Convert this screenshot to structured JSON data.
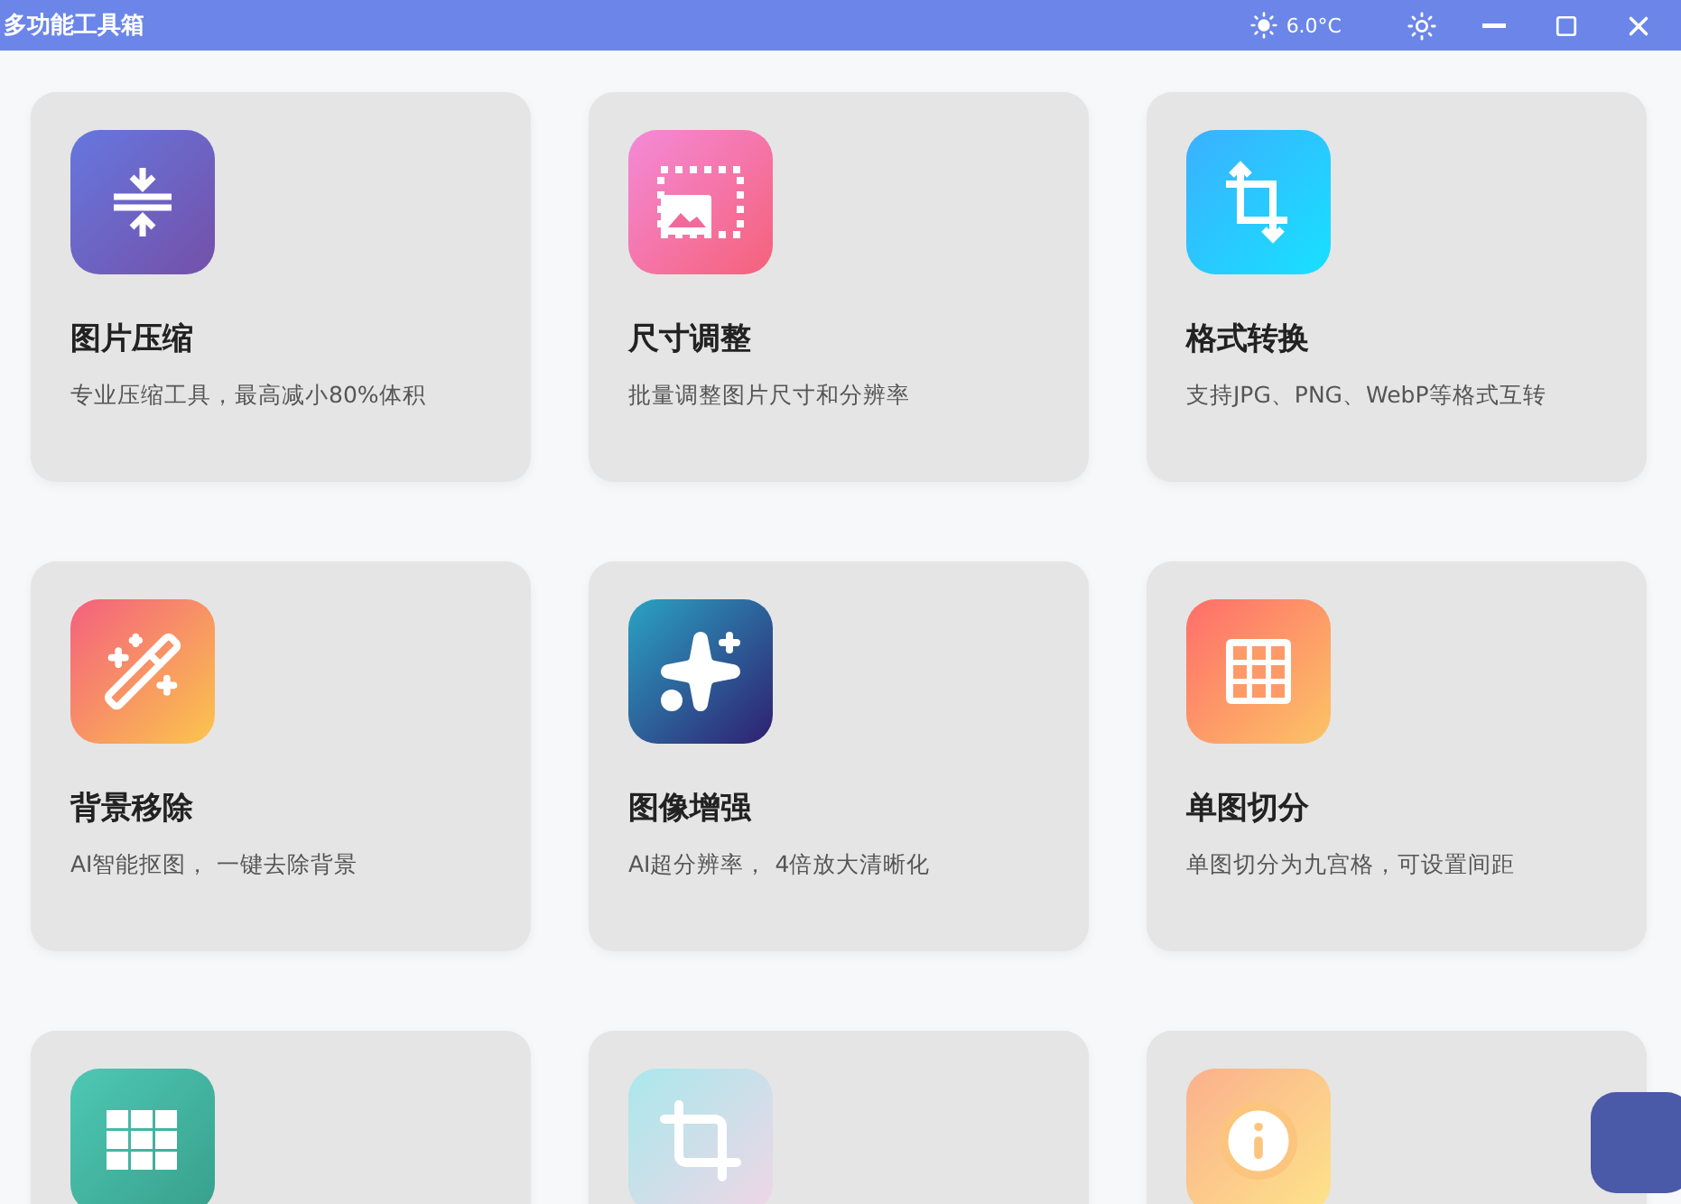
{
  "window": {
    "title": "多功能工具箱",
    "temperature": "6.0°C"
  },
  "tools": [
    {
      "kind": "compress",
      "title": "图片压缩",
      "description": "专业压缩工具，最高减小80%体积"
    },
    {
      "kind": "resize",
      "title": "尺寸调整",
      "description": "批量调整图片尺寸和分辨率"
    },
    {
      "kind": "convert",
      "title": "格式转换",
      "description": "支持JPG、PNG、WebP等格式互转"
    },
    {
      "kind": "wand",
      "title": "背景移除",
      "description": "AI智能抠图， 一键去除背景"
    },
    {
      "kind": "sparkles",
      "title": "图像增强",
      "description": "AI超分辨率， 4倍放大清晰化"
    },
    {
      "kind": "grid",
      "title": "单图切分",
      "description": "单图切分为九宫格，可设置间距"
    },
    {
      "kind": "tiles"
    },
    {
      "kind": "crop"
    },
    {
      "kind": "info"
    }
  ]
}
